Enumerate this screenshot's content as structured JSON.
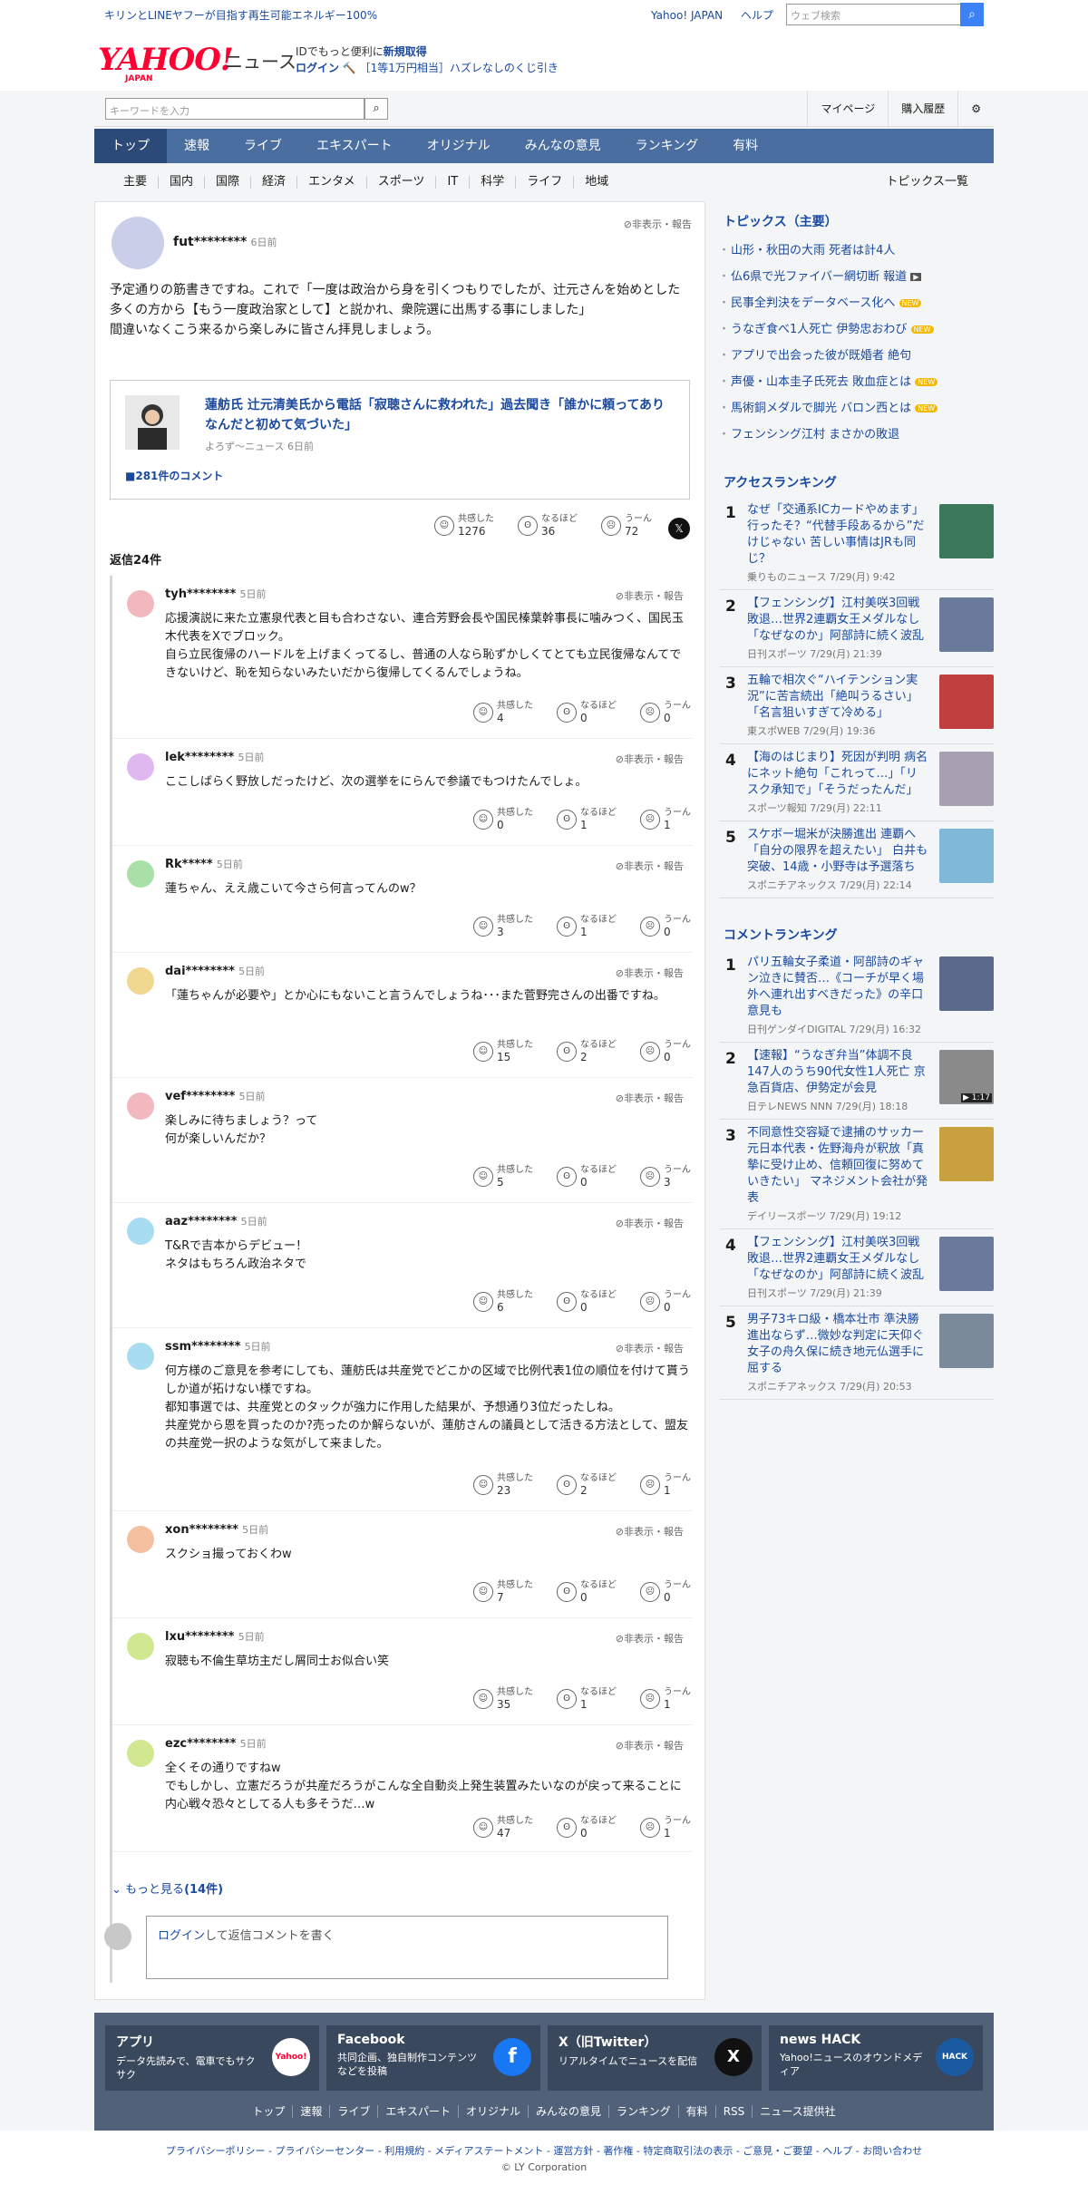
{
  "top": {
    "promo": "キリンとLINEヤフーが目指す再生可能エネルギー100%",
    "yahoo_japan": "Yahoo! JAPAN",
    "help": "ヘルプ",
    "web_search_placeholder": "ウェブ検索"
  },
  "header": {
    "logo": "YAHOO!",
    "logo_sub": "JAPAN",
    "news": "ニュース",
    "id_promo_a": "IDでもっと便利に",
    "id_promo_b": "新規取得",
    "login": "ログイン",
    "lottery": "［1等1万円相当］ハズレなしのくじ引き"
  },
  "search": {
    "placeholder": "キーワードを入力",
    "mypage": "マイページ",
    "history": "購入履歴"
  },
  "nav": [
    "トップ",
    "速報",
    "ライブ",
    "エキスパート",
    "オリジナル",
    "みんなの意見",
    "ランキング",
    "有料"
  ],
  "subnav": [
    "主要",
    "国内",
    "国際",
    "経済",
    "エンタメ",
    "スポーツ",
    "IT",
    "科学",
    "ライフ",
    "地域"
  ],
  "topics_all": "トピックス一覧",
  "main_comment": {
    "user": "fut********",
    "time": "6日前",
    "hide": "非表示・報告",
    "body": [
      "予定通りの筋書きですね。これで「一度は政治から身を引くつもりでしたが、辻元さんを始めとした多くの方から【もう一度政治家として】と説かれ、衆院選に出馬する事にしました」",
      "間違いなくこう来るから楽しみに皆さん拝見しましょう。"
    ],
    "link_title": "蓮舫氏 辻元清美氏から電話「寂聴さんに救われた」過去聞き「誰かに頼ってありなんだと初めて気づいた」",
    "link_src": "よろず〜ニュース 6日前",
    "comment_count": "281件のコメント",
    "reactions": [
      {
        "label": "共感した",
        "count": "1276"
      },
      {
        "label": "なるほど",
        "count": "36"
      },
      {
        "label": "うーん",
        "count": "72"
      }
    ]
  },
  "reply_count": "返信24件",
  "replies": [
    {
      "user": "tyh********",
      "time": "5日前",
      "color": "#f2b8c0",
      "text": "応援演説に来た立憲泉代表と目も合わさない、連合芳野会長や国民榛葉幹事長に噛みつく、国民玉木代表をXでブロック。\n自ら立民復帰のハードルを上げまくってるし、普通の人なら恥ずかしくてとても立民復帰なんてできないけど、恥を知らないみたいだから復帰してくるんでしょうね。",
      "r": [
        "4",
        "0",
        "0"
      ]
    },
    {
      "user": "lek********",
      "time": "5日前",
      "color": "#e0b8f0",
      "text": "ここしばらく野放しだったけど、次の選挙をにらんで参議でもつけたんでしょ。",
      "r": [
        "0",
        "1",
        "1"
      ]
    },
    {
      "user": "Rk*****",
      "time": "5日前",
      "color": "#a8e0a8",
      "text": "蓮ちゃん、ええ歳こいて今さら何言ってんのw？",
      "r": [
        "3",
        "1",
        "0"
      ]
    },
    {
      "user": "dai********",
      "time": "5日前",
      "color": "#f0d890",
      "text": "「蓮ちゃんが必要や」とか心にもないこと言うんでしょうね･･･また菅野完さんの出番ですね。",
      "r": [
        "15",
        "2",
        "0"
      ]
    },
    {
      "user": "vef********",
      "time": "5日前",
      "color": "#f2b8c0",
      "text": "楽しみに待ちましょう？って\n何が楽しいんだか？",
      "r": [
        "5",
        "0",
        "3"
      ]
    },
    {
      "user": "aaz********",
      "time": "5日前",
      "color": "#a8dcf0",
      "text": "T&Rで吉本からデビュー！\nネタはもちろん政治ネタで",
      "r": [
        "6",
        "0",
        "0"
      ]
    },
    {
      "user": "ssm********",
      "time": "5日前",
      "color": "#a8dcf0",
      "text": "何方様のご意見を参考にしても、蓮舫氏は共産党でどこかの区域で比例代表1位の順位を付けて貰うしか道が拓けない様ですね。\n都知事選では、共産党とのタックが強力に作用した結果が、予想通り3位だったしね。\n共産党から恩を買ったのか?売ったのか解らないが、蓮舫さんの議員として活きる方法として、盟友の共産党一択のような気がして来ました。",
      "r": [
        "23",
        "2",
        "1"
      ]
    },
    {
      "user": "xon********",
      "time": "5日前",
      "color": "#f5c0a0",
      "text": "スクショ撮っておくわw",
      "r": [
        "7",
        "0",
        "0"
      ]
    },
    {
      "user": "lxu********",
      "time": "5日前",
      "color": "#d0e890",
      "text": "寂聴も不倫生草坊主だし屑同士お似合い笑",
      "r": [
        "35",
        "1",
        "1"
      ]
    },
    {
      "user": "ezc********",
      "time": "5日前",
      "color": "#d0e890",
      "text": "全くその通りですねw\nでもしかし、立憲だろうが共産だろうがこんな全自動炎上発生装置みたいなのが戻って来ることに内心戦々恐々としてる人も多そうだ…w",
      "r": [
        "47",
        "0",
        "1"
      ]
    }
  ],
  "reaction_labels": [
    "共感した",
    "なるほど",
    "うーん"
  ],
  "more": {
    "text": "もっと見る",
    "count": "(14件)"
  },
  "write": {
    "login": "ログイン",
    "rest": "して返信コメントを書く"
  },
  "sidebar": {
    "topics_title": "トピックス（主要）",
    "topics": [
      {
        "t": "山形・秋田の大雨 死者は計4人",
        "badge": ""
      },
      {
        "t": "仏6県で光ファイバー網切断 報道",
        "badge": "video"
      },
      {
        "t": "民事全判決をデータベース化へ",
        "badge": "NEW"
      },
      {
        "t": "うなぎ食べ1人死亡 伊勢忠おわび",
        "badge": "NEW"
      },
      {
        "t": "アプリで出会った彼が既婚者 絶句",
        "badge": ""
      },
      {
        "t": "声優・山本圭子氏死去 敗血症とは",
        "badge": "NEW"
      },
      {
        "t": "馬術銅メダルで脚光 バロン西とは",
        "badge": "NEW"
      },
      {
        "t": "フェンシング江村 まさかの敗退",
        "badge": ""
      }
    ],
    "access_title": "アクセスランキング",
    "access": [
      {
        "t": "なぜ「交通系ICカードやめます」 行ったそ？“代替手段あるから”だけじゃない 苦しい事情はJRも同じ？",
        "s": "乗りものニュース 7/29(月) 9:42",
        "c": "#3a7a5a"
      },
      {
        "t": "【フェンシング】江村美咲3回戦敗退…世界2連覇女王メダルなし「なぜなのか」阿部詩に続く波乱",
        "s": "日刊スポーツ 7/29(月) 21:39",
        "c": "#6a7a9a"
      },
      {
        "t": "五輪で相次ぐ“ハイテンション実況”に苦言続出「絶叫うるさい」「名言狙いすぎて冷める」",
        "s": "東スポWEB 7/29(月) 19:36",
        "c": "#c04040"
      },
      {
        "t": "【海のはじまり】死因が判明 病名にネット絶句「これって…」「リスク承知で」「そうだったんだ」",
        "s": "スポーツ報知 7/29(月) 22:11",
        "c": "#a8a0b0"
      },
      {
        "t": "スケボー堀米が決勝進出 連覇へ「自分の限界を超えたい」 白井も突破、14歳・小野寺は予選落ち",
        "s": "スポニチアネックス 7/29(月) 22:14",
        "c": "#80b8d8"
      }
    ],
    "comment_title": "コメントランキング",
    "comments": [
      {
        "t": "パリ五輪女子柔道・阿部詩のギャン泣きに賛否…《コーチが早く場外へ連れ出すべきだった》の辛口意見も",
        "s": "日刊ゲンダイDIGITAL 7/29(月) 16:32",
        "c": "#5a6a8a"
      },
      {
        "t": "【速報】“うなぎ弁当”体調不良147人のうち90代女性1人死亡 京急百貨店、伊勢定が会見",
        "s": "日テレNEWS NNN 7/29(月) 18:18",
        "c": "#8a8a8a",
        "video": "▶ 1:17"
      },
      {
        "t": "不同意性交容疑で逮捕のサッカー元日本代表・佐野海舟が釈放「真摯に受け止め、信頼回復に努めていきたい」 マネジメント会社が発表",
        "s": "デイリースポーツ 7/29(月) 19:12",
        "c": "#c8a040"
      },
      {
        "t": "【フェンシング】江村美咲3回戦敗退…世界2連覇女王メダルなし「なぜなのか」阿部詩に続く波乱",
        "s": "日刊スポーツ 7/29(月) 21:39",
        "c": "#6a7a9a"
      },
      {
        "t": "男子73キロ級・橋本壮市 準決勝進出ならず…微妙な判定に天仰ぐ 女子の舟久保に続き地元仏選手に屈する",
        "s": "スポニチアネックス 7/29(月) 20:53",
        "c": "#7a8a9a"
      }
    ]
  },
  "footer": {
    "apps": [
      {
        "name": "アプリ",
        "desc": "データ先読みで、電車でもサクサク",
        "icon": "Yahoo!"
      },
      {
        "name": "Facebook",
        "desc": "共同企画、独自制作コンテンツなどを投稿",
        "icon": "f"
      },
      {
        "name": "X（旧Twitter）",
        "desc": "リアルタイムでニュースを配信",
        "icon": "X"
      },
      {
        "name": "news HACK",
        "desc": "Yahoo!ニュースのオウンドメディア",
        "icon": "HACK"
      }
    ],
    "links": [
      "トップ",
      "速報",
      "ライブ",
      "エキスパート",
      "オリジナル",
      "みんなの意見",
      "ランキング",
      "有料",
      "RSS",
      "ニュース提供社"
    ],
    "policy": "プライバシーポリシー - プライバシーセンター - 利用規約 - メディアステートメント - 運営方針 - 著作権 - 特定商取引法の表示 - ご意見・ご要望 - ヘルプ - お問い合わせ",
    "copyright": "© LY Corporation"
  }
}
